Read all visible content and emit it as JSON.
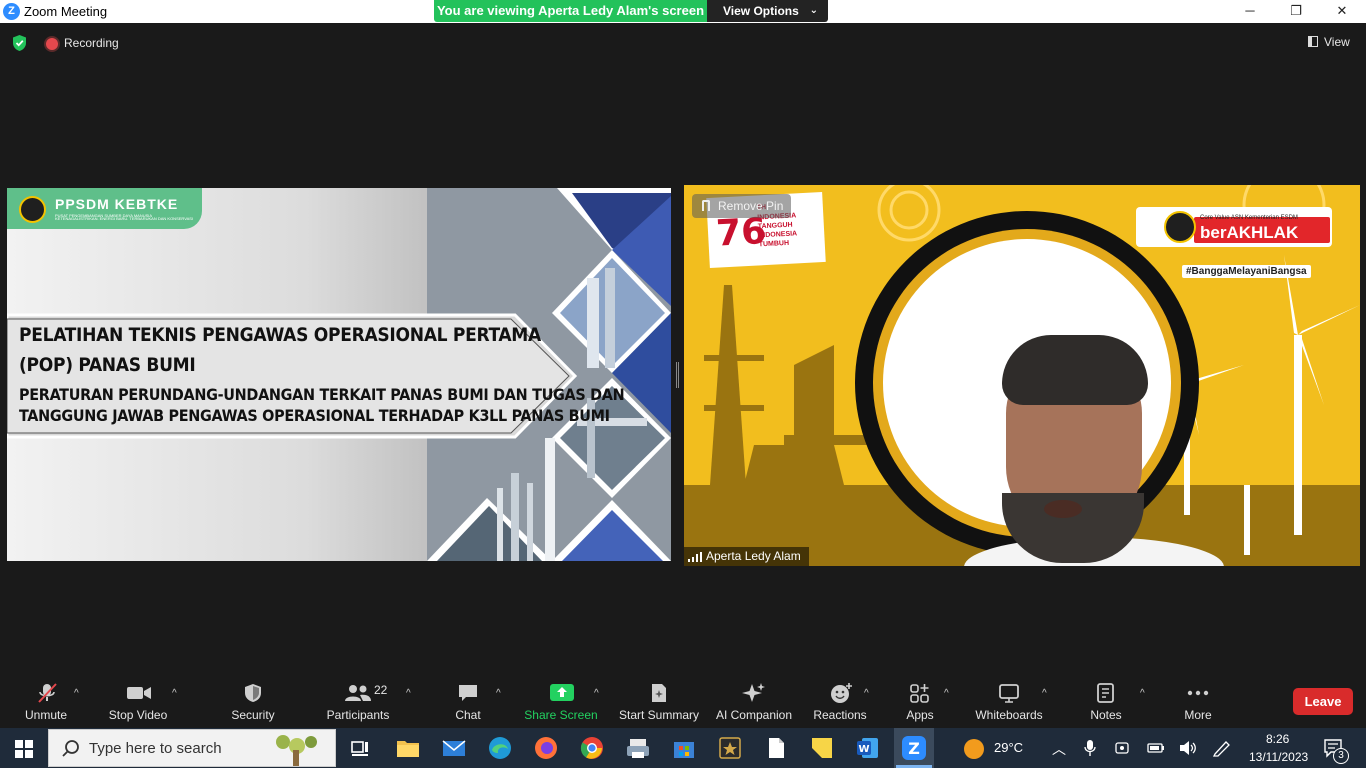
{
  "window": {
    "title": "Zoom Meeting",
    "logo_letter": "Z",
    "minimize": "─",
    "restore": "❐",
    "close": "✕"
  },
  "banner": {
    "viewing_text": "You are viewing Aperta Ledy Alam's screen",
    "view_options_label": "View Options",
    "view_options_chevron": "⌄"
  },
  "meeting": {
    "recording_label": "Recording",
    "view_label": "View"
  },
  "slide": {
    "org_name": "PPSDM KEBTKE",
    "org_subtitle": "PUSAT PENGEMBANGAN SUMBER DAYA MANUSIA KETENAGALISTRIKAN, ENERGI BARU, TERBARUKAN DAN KONSERVASI ENERGI",
    "title_line1": "PELATIHAN TEKNIS PENGAWAS OPERASIONAL PERTAMA",
    "title_line2": "(POP) PANAS BUMI",
    "subtitle_line1": "PERATURAN PERUNDANG-UNDANGAN TERKAIT PANAS BUMI DAN TUGAS DAN",
    "subtitle_line2": "TANGGUNG JAWAB PENGAWAS OPERASIONAL TERHADAP K3LL PANAS BUMI"
  },
  "video": {
    "remove_pin_label": "Remove Pin",
    "participant_name": "Aperta Ledy Alam",
    "hut_number": "76",
    "hut_suffix": "TH",
    "hut_line1": "INDONESIA",
    "hut_line2": "TANGGUH",
    "hut_line3": "INDONESIA",
    "hut_line4": "TUMBUH",
    "akhlak_sub": "Core Value ASN Kementerian ESDM",
    "akhlak_name": "berAKHLAK",
    "hashtag": "#BanggaMelayaniBangsa"
  },
  "toolbar": {
    "unmute": "Unmute",
    "stop_video": "Stop Video",
    "security": "Security",
    "participants": "Participants",
    "participants_count": "22",
    "chat": "Chat",
    "share_screen": "Share Screen",
    "start_summary": "Start Summary",
    "ai_companion": "AI Companion",
    "reactions": "Reactions",
    "apps": "Apps",
    "whiteboards": "Whiteboards",
    "notes": "Notes",
    "more": "More",
    "leave": "Leave",
    "caret": "^"
  },
  "taskbar": {
    "search_placeholder": "Type here to search",
    "temperature": "29°C",
    "time": "8:26",
    "date": "13/11/2023",
    "notification_count": "3"
  },
  "colors": {
    "zoom_blue": "#2d8cff",
    "banner_green": "#23c25b",
    "leave_red": "#d92b2b",
    "video_yellow": "#f2be1e",
    "slide_green": "#5fbf8a"
  }
}
